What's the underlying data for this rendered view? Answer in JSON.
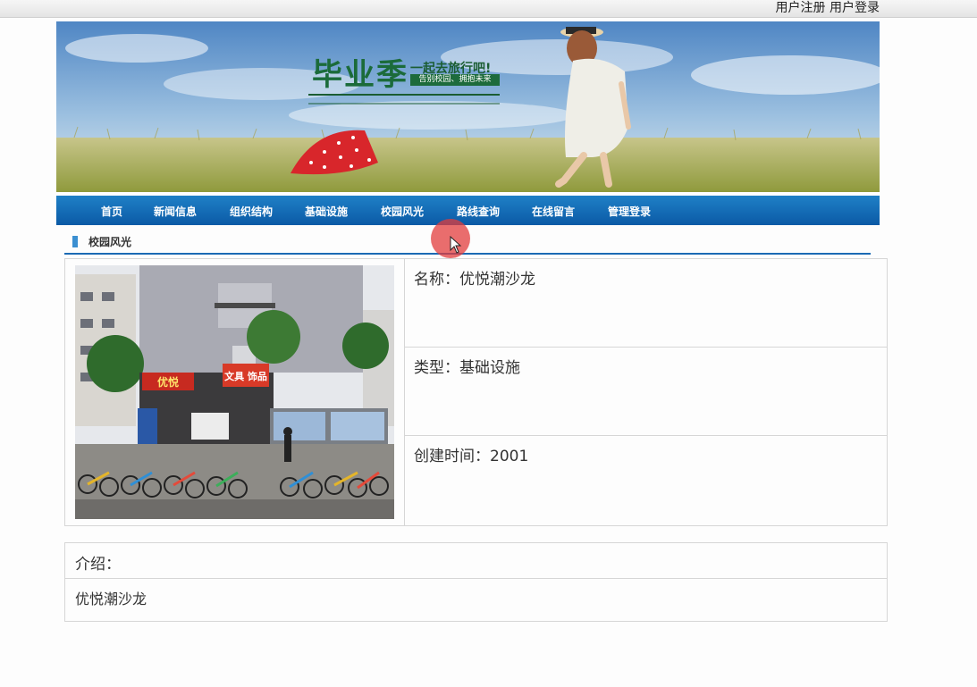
{
  "topbar": {
    "register_label": "用户注册",
    "login_label": "用户登录"
  },
  "banner": {
    "title": "毕业季",
    "subtitle": "一起去旅行吧!",
    "tagline": "告别校园、拥抱未来"
  },
  "nav": {
    "items": [
      "首页",
      "新闻信息",
      "组织结构",
      "基础设施",
      "校园风光",
      "路线查询",
      "在线留言",
      "管理登录"
    ]
  },
  "section": {
    "title": "校园风光"
  },
  "detail": {
    "name_label": "名称：",
    "name_value": "优悦潮沙龙",
    "type_label": "类型：",
    "type_value": "基础设施",
    "created_label": "创建时间：",
    "created_value": "2001",
    "photo_sign_main": "优悦",
    "photo_sign_shop": "文具 饰品"
  },
  "intro": {
    "label": "介绍：",
    "body": "优悦潮沙龙"
  },
  "colors": {
    "nav_blue": "#0b5aa6",
    "accent_green": "#1b6b3a",
    "cursor": "#e13c3c"
  }
}
